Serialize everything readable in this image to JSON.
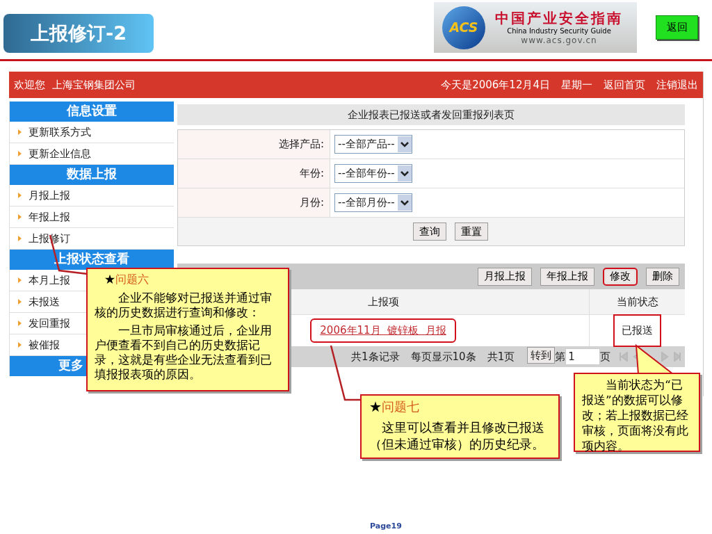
{
  "slide": {
    "title": "上报修订-2",
    "page": "Page19"
  },
  "logo": {
    "badge": "ACS",
    "title": "中国产业安全指南",
    "subtitle": "China Industry Security Guide",
    "url": "www.acs.gov.cn"
  },
  "return_button": "返回",
  "header": {
    "welcome": "欢迎您  上海宝钢集团公司",
    "date": "今天是2006年12月4日",
    "weekday": "星期一",
    "links": [
      "返回首页",
      "注销退出"
    ]
  },
  "sidebar": [
    {
      "heading": "信息设置",
      "items": [
        "更新联系方式",
        "更新企业信息"
      ]
    },
    {
      "heading": "数据上报",
      "items": [
        "月报上报",
        "年报上报",
        "上报修订"
      ]
    },
    {
      "heading": "上报状态查看",
      "items": [
        "本月上报",
        "未报送",
        "发回重报",
        "被催报"
      ]
    },
    {
      "heading": "更多"
    }
  ],
  "page_title": "企业报表已报送或者发回重报列表页",
  "filters": [
    {
      "label": "选择产品:",
      "value": "--全部产品--"
    },
    {
      "label": "年份:",
      "value": "--全部年份--"
    },
    {
      "label": "月份:",
      "value": "--全部月份--"
    }
  ],
  "form_buttons": [
    "查询",
    "重置"
  ],
  "toolbar": [
    {
      "label": "月报上报",
      "highlighted": false
    },
    {
      "label": "年报上报",
      "highlighted": false
    },
    {
      "label": "修改",
      "highlighted": true
    },
    {
      "label": "删除",
      "highlighted": false
    }
  ],
  "table": {
    "columns": [
      "上报项",
      "当前状态"
    ],
    "rows": [
      {
        "item": "2006年11月  镀锌板  月报",
        "status": "已报送",
        "item_highlighted": true,
        "status_highlighted": true
      }
    ]
  },
  "pager": {
    "total": "共1条记录",
    "per_page": "每页显示10条",
    "pages": "共1页",
    "go": "转到",
    "prefix": "第",
    "page": "1",
    "suffix": "页"
  },
  "callouts": [
    {
      "star": "★",
      "title": "问题六",
      "paragraphs": [
        "企业不能够对已报送并通过审核的历史数据进行查询和修改：",
        "一旦市局审核通过后，企业用户便查看不到自己的历史数据记录，这就是有些企业无法查看到已填报报表项的原因。"
      ]
    },
    {
      "star": "★",
      "title": "问题七",
      "paragraphs": [
        "这里可以查看并且修改已报送（但未通过审核）的历史纪录。"
      ]
    },
    {
      "paragraphs": [
        "当前状态为“已报送”的数据可以修改；若上报数据已经审核，页面将没有此项内容。"
      ]
    }
  ]
}
